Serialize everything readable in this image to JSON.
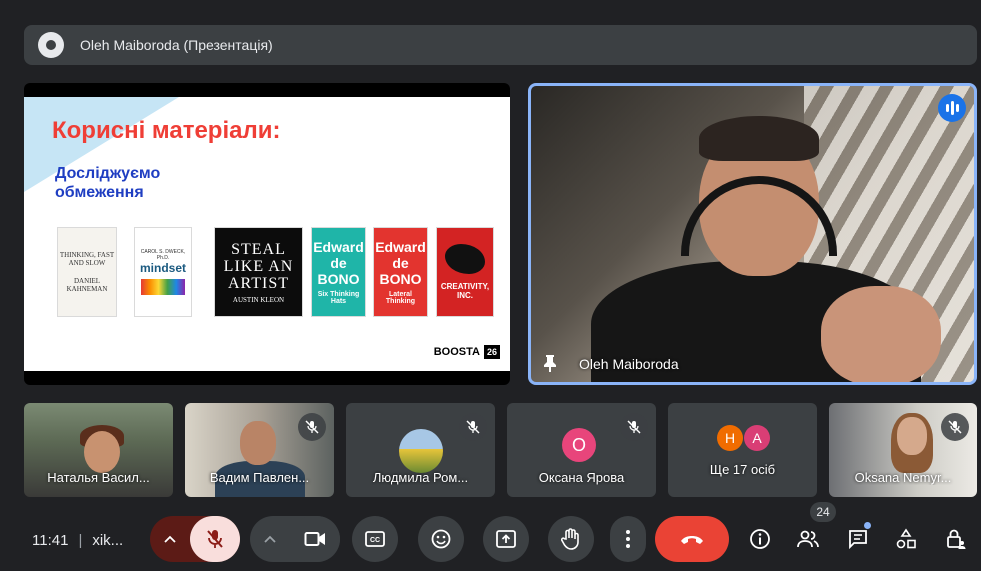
{
  "presentation_bar": {
    "title": "Oleh Maiboroda (Презентація)"
  },
  "slide": {
    "heading": "Корисні матеріали:",
    "subheading": "Досліджуємо обмеження",
    "books": [
      {
        "title": "THINKING, FAST AND SLOW",
        "author": "DANIEL KAHNEMAN"
      },
      {
        "title": "mindset",
        "author": "CAROL S. DWECK, Ph.D."
      },
      {
        "title": "STEAL LIKE AN ARTIST",
        "author": "AUSTIN KLEON"
      },
      {
        "title": "Six Thinking Hats",
        "author": "Edward de BONO"
      },
      {
        "title": "Lateral Thinking",
        "author": "Edward de BONO"
      },
      {
        "title": "CREATIVITY, INC.",
        "author": ""
      }
    ],
    "logo_text": "BOOSTA",
    "logo_num": "26"
  },
  "speaker": {
    "name": "Oleh Maiboroda"
  },
  "participants": [
    {
      "name": "Наталья Васил..."
    },
    {
      "name": "Вадим Павлен..."
    },
    {
      "name": "Людмила Ром..."
    },
    {
      "name": "Оксана Ярова",
      "initial": "О"
    },
    {
      "name": "Ще 17 осіб",
      "initials": [
        "Н",
        "А"
      ]
    },
    {
      "name": "Oksana Nemyr..."
    }
  ],
  "bottom_bar": {
    "time": "11:41",
    "meeting_code": "xik...",
    "people_count": "24"
  },
  "colors": {
    "end_call": "#ea4335",
    "mic_off_bg": "#f9dedc",
    "speaker_border": "#8ab4f8"
  }
}
